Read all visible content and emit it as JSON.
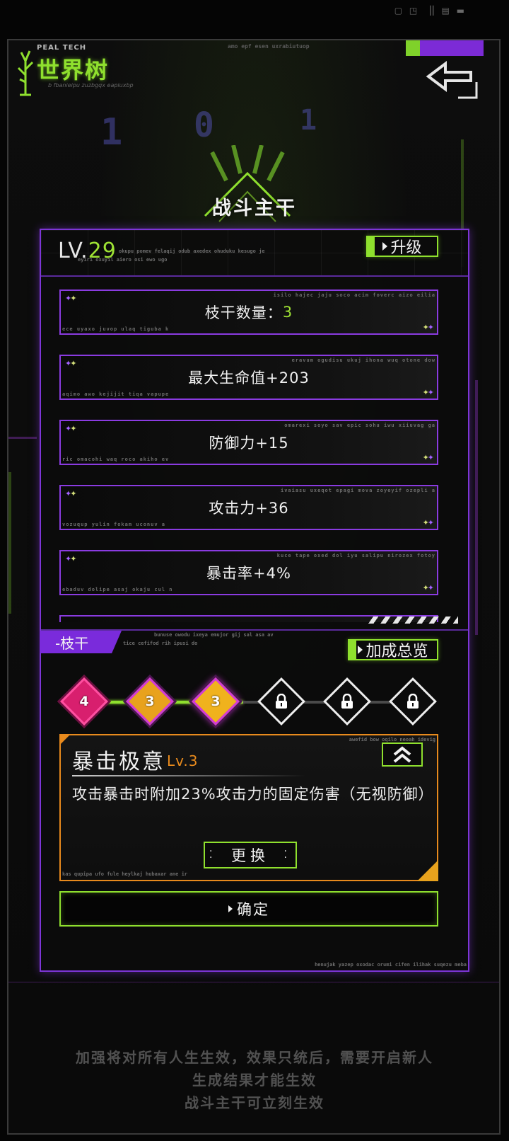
{
  "header": {
    "logo_small": "PEAL TECH",
    "logo_title": "世界树",
    "logo_sub": "b fbanieipu zuzbgqx eapiuxbp",
    "back_icon": "back-arrow-icon",
    "status_bar": "▢ ◳ ▕▏▤ ▬",
    "strip_text": "amo epf esen uxrabiutuop"
  },
  "page_title": "战斗主干",
  "level": {
    "prefix": "LV.",
    "value": "29",
    "caption1": "okupu pomev felaqij odub axedex ohuduku kesugo je",
    "caption2": "eyiri oxuyil aiero osi ewo ugo",
    "upgrade_label": "升级"
  },
  "stats": [
    {
      "label": "枝干数量：",
      "value": "3",
      "caption_tr": "isilo hajec jaju soco acim foverc aizo eilia",
      "caption_bl": "ece uyaxo juvop ulaq tiguba k"
    },
    {
      "label": "最大生命值+203",
      "value": "",
      "caption_tr": "eravum ogudisu ukuj ihona wuq otone dow",
      "caption_bl": "aqimo awo kejijit tiqa vapupe"
    },
    {
      "label": "防御力+15",
      "value": "",
      "caption_tr": "omarexi soyo sav epic sohu iwu xiiuvag ga",
      "caption_bl": "ric omacohi waq roco akiho ev"
    },
    {
      "label": "攻击力+36",
      "value": "",
      "caption_tr": "ivaiasu uxeqot epagi mova zoyeyif ozepli a",
      "caption_bl": "vozuqup yulin fokam uconuv a"
    },
    {
      "label": "暴击率+4%",
      "value": "",
      "caption_tr": "kuce tape oxed dol iyu salipu nirozex fotoy",
      "caption_bl": "ebaduv dolipe asaj okaju cul n"
    }
  ],
  "branch": {
    "tab_label": "-枝干",
    "caption1": "bunuse owodu ixeya emujor gij sal asa av",
    "caption2": "tice cefifod rih ipusi do",
    "overview_label": "加成总览",
    "nodes": [
      {
        "label": "4",
        "state": "unlocked",
        "color": "#d81f6e"
      },
      {
        "label": "3",
        "state": "unlocked",
        "color": "#e8a21d"
      },
      {
        "label": "3",
        "state": "selected",
        "color": "#f0b21d"
      },
      {
        "label": "",
        "state": "locked",
        "icon": "lock-icon"
      },
      {
        "label": "",
        "state": "locked",
        "icon": "lock-icon"
      },
      {
        "label": "",
        "state": "locked",
        "icon": "lock-icon"
      }
    ]
  },
  "skill": {
    "name": "暴击极意",
    "level": "Lv.3",
    "caption_tr": "awefid bow oqilo neoah idevig",
    "caption_bl": "kas qupipa ufo fule heylkaj hubaxar ane ir",
    "description": "攻击暴击时附加23%攻击力的固定伤害（无视防御）",
    "swap_label": "更换",
    "upgrade_icon": "double-chevron-up-icon"
  },
  "confirm_label": "确定",
  "panel_caption": "henujak yazep oxodac orumi cifen ilihak suqezu meba",
  "footer": {
    "line1": "加强将对所有人生生效，效果只统后，需要开启新人",
    "line2": "生成结果才能生效",
    "line3": "战斗主干可立刻生效"
  },
  "colors": {
    "accent_purple": "#7d35d6",
    "accent_green": "#8fe02e",
    "accent_orange": "#e88a1d"
  }
}
